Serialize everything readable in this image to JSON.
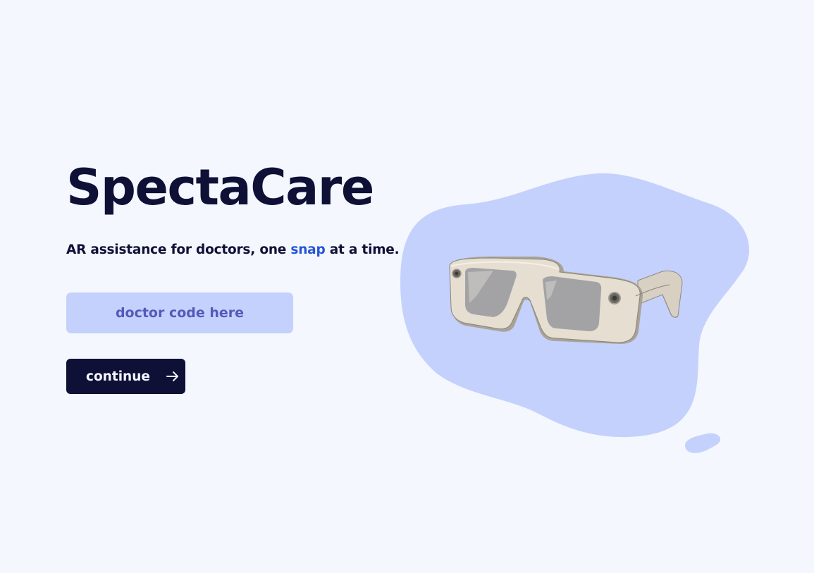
{
  "brand": {
    "title": "SpectaCare"
  },
  "tagline": {
    "before": "AR assistance for doctors, one ",
    "accent": "snap",
    "after": " at a time."
  },
  "form": {
    "code_placeholder": "doctor code here",
    "code_value": "",
    "continue_label": "continue"
  },
  "icons": {
    "continue": "arrow-right-icon",
    "hero": "smart-glasses-icon"
  },
  "colors": {
    "background": "#f4f7fe",
    "primary_dark": "#0e1036",
    "accent_blue": "#2455d8",
    "input_bg": "#c4d1fd",
    "input_text": "#5459b9",
    "blob": "#c4d1fd"
  }
}
